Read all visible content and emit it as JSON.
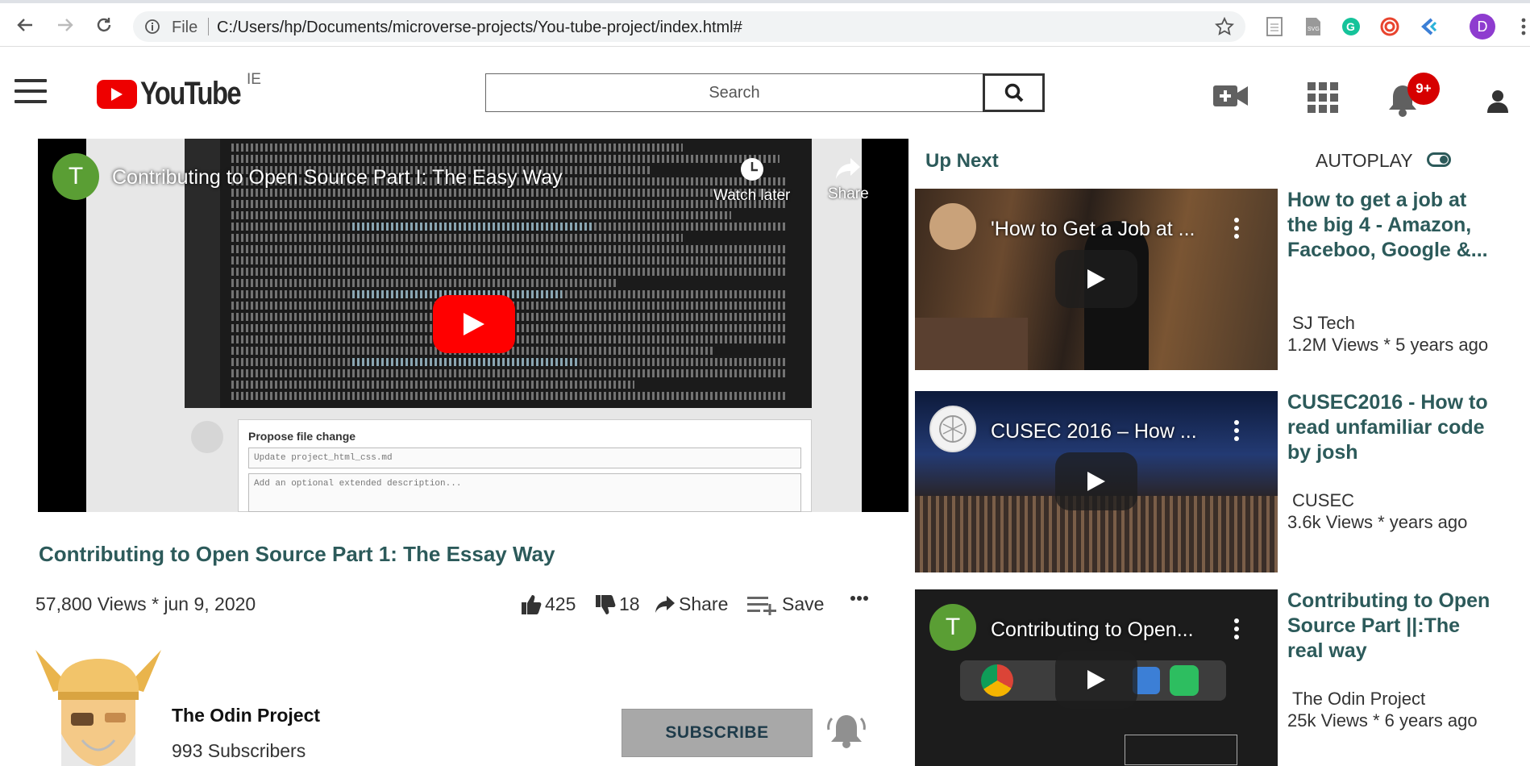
{
  "browser": {
    "file_label": "File",
    "url": "C:/Users/hp/Documents/microverse-projects/You-tube-project/index.html#",
    "profile_initial": "D"
  },
  "header": {
    "logo_text": "YouTube",
    "logo_suffix": "IE",
    "search_placeholder": "Search",
    "notification_badge": "9+"
  },
  "player": {
    "overlay_title": "Contributing to Open Source Part I: The Easy Way",
    "channel_initial": "T",
    "watch_later_label": "Watch later",
    "share_label": "Share",
    "form_title": "Propose file change",
    "form_input_placeholder": "Update project_html_css.md",
    "form_description_placeholder": "Add an optional extended description..."
  },
  "video": {
    "title": "Contributing to Open Source Part 1: The Essay Way",
    "views": "57,800 Views * jun 9, 2020",
    "likes": "425",
    "dislikes": "18",
    "share_label": "Share",
    "save_label": "Save",
    "channel_name": "The Odin Project",
    "subscribers": "993 Subscribers",
    "subscribe_label": "SUBSCRIBE"
  },
  "sidebar": {
    "up_next_label": "Up Next",
    "autoplay_label": "AUTOPLAY",
    "videos": [
      {
        "thumb_title": "'How to Get a Job at ...",
        "title": " How to get a job at the big 4 - Amazon, Faceboo, Google &...",
        "channel": "SJ Tech",
        "meta": "1.2M Views * 5 years ago"
      },
      {
        "thumb_title": "CUSEC 2016 – How ...",
        "title": "CUSEC2016 - How to read unfamiliar code by josh",
        "channel": "CUSEC",
        "meta": "3.6k Views * years ago"
      },
      {
        "thumb_title": "Contributing to Open...",
        "channel_initial": "T",
        "title": "Contributing to Open Source Part ||:The real way",
        "channel": "The Odin Project",
        "meta": "25k Views * 6 years ago"
      }
    ]
  },
  "colors": {
    "accent": "#2c5a5a",
    "youtube_red": "#ff0000",
    "subscribe_bg": "#a8a8a8"
  }
}
